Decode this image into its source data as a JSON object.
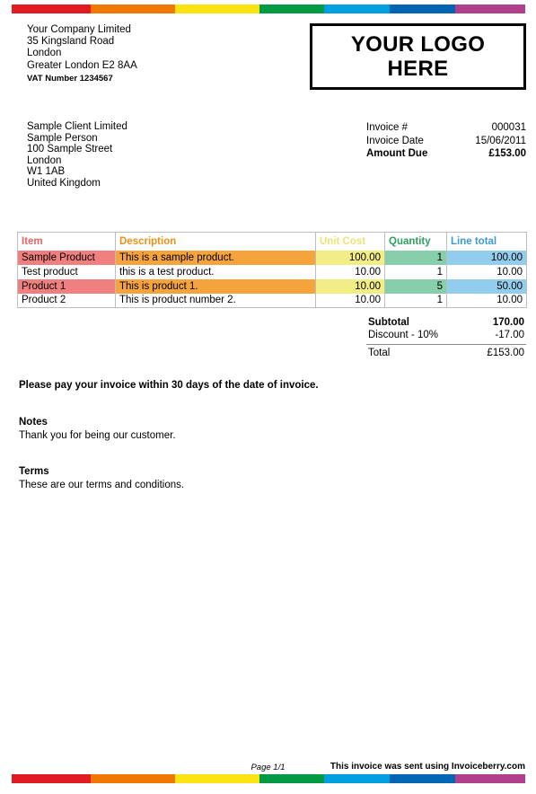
{
  "rainbow": {
    "colors": [
      "#e01b24",
      "#f07800",
      "#fbe211",
      "#009944",
      "#00a0e0",
      "#0066b3",
      "#b0408c"
    ],
    "widths": [
      17,
      18,
      18,
      14,
      14,
      14,
      15
    ]
  },
  "company": {
    "name": "Your Company Limited",
    "address1": "35 Kingsland Road",
    "city": "London",
    "region": "Greater London E2 8AA",
    "vat": "VAT Number 1234567"
  },
  "logo": {
    "line1": "YOUR LOGO",
    "line2": "HERE"
  },
  "client": {
    "company": "Sample Client Limited",
    "person": "Sample Person",
    "street": "100 Sample Street",
    "city": "London",
    "postcode": "W1 1AB",
    "country": "United Kingdom"
  },
  "meta": {
    "invoice_number_label": "Invoice #",
    "invoice_number_value": "000031",
    "invoice_date_label": "Invoice Date",
    "invoice_date_value": "15/06/2011",
    "amount_due_label": "Amount Due",
    "amount_due_value": "£153.00"
  },
  "table": {
    "headers": [
      {
        "label": "Item",
        "color": "#e06666",
        "accent": "#f08080"
      },
      {
        "label": "Description",
        "color": "#e8911a",
        "accent": "#f5a33c"
      },
      {
        "label": "Unit Cost",
        "color": "#ece37a",
        "accent": "#f3ed85"
      },
      {
        "label": "Quantity",
        "color": "#2f9e63",
        "accent": "#87ceab"
      },
      {
        "label": "Line total",
        "color": "#3d9ad1",
        "accent": "#92cdee"
      }
    ],
    "rows": [
      {
        "item": "Sample Product",
        "description": "This is a sample product.",
        "unit_cost": "100.00",
        "quantity": "1",
        "line_total": "100.00",
        "shaded": true
      },
      {
        "item": "Test product",
        "description": "this is a test product.",
        "unit_cost": "10.00",
        "quantity": "1",
        "line_total": "10.00",
        "shaded": false
      },
      {
        "item": "Product 1",
        "description": "This is product 1.",
        "unit_cost": "10.00",
        "quantity": "5",
        "line_total": "50.00",
        "shaded": true
      },
      {
        "item": "Product 2",
        "description": "This is product number 2.",
        "unit_cost": "10.00",
        "quantity": "1",
        "line_total": "10.00",
        "shaded": false
      }
    ]
  },
  "totals": {
    "subtotal_label": "Subtotal",
    "subtotal_value": "170.00",
    "discount_label": "Discount - 10%",
    "discount_value": "-17.00",
    "total_label": "Total",
    "total_value": "£153.00"
  },
  "pay_message": "Please pay your invoice within 30 days of the date of invoice.",
  "notes": {
    "title": "Notes",
    "body": "Thank you for being our customer."
  },
  "terms": {
    "title": "Terms",
    "body": "These are our terms and conditions."
  },
  "footer": {
    "page": "Page 1/1",
    "note": "This invoice was sent using Invoiceberry.com"
  }
}
